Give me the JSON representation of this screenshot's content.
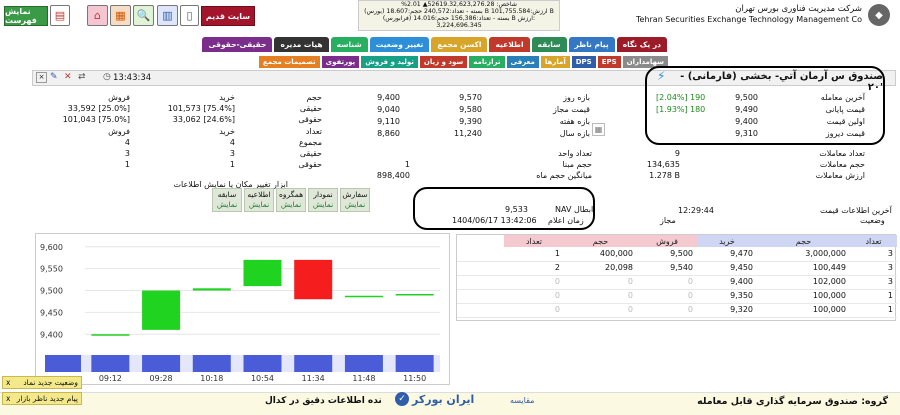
{
  "top_left": {
    "show_list": "نمایش فهرست",
    "old_site": "سایت قدیم"
  },
  "company": {
    "fa": "شرکت مدیریت فناوری بورس تهران",
    "en": "Tehran Securities Exchange Technology Management Co"
  },
  "ticker": {
    "line1": "%2.01 ▲52619.32,623,276.28 :شاخص",
    "line2": "(بورس) بسته - تعداد:240,572 حجم:18.607 B ارزش:101,755.584 B",
    "line3": "(فرابورس) بسته - تعداد:156,386 حجم:14.016 B ارزش:",
    "line4": "3,224,696.345"
  },
  "tabs_row1": [
    {
      "label": "در یک نگاه",
      "color": "#9b1b28"
    },
    {
      "label": "پیام ناظر",
      "color": "#3478c3"
    },
    {
      "label": "سابقه",
      "color": "#2e8b57"
    },
    {
      "label": "اطلاعیه",
      "color": "#c0392b"
    },
    {
      "label": "اکسن مجمع",
      "color": "#d8a42a"
    },
    {
      "label": "تغییر وضعیت",
      "color": "#2d8fd8"
    },
    {
      "label": "شناسه",
      "color": "#27ae60"
    },
    {
      "label": "هیات مدیره",
      "color": "#333"
    },
    {
      "label": "حقیقی-حقوقی",
      "color": "#7b2d8b"
    }
  ],
  "tabs_row2": [
    {
      "label": "سهامداران",
      "color": "#8a8a8a"
    },
    {
      "label": "EPS",
      "color": "#c0392b"
    },
    {
      "label": "DPS",
      "color": "#2f5da8"
    },
    {
      "label": "آمارها",
      "color": "#d8a42a"
    },
    {
      "label": "معرفی",
      "color": "#2980b9"
    },
    {
      "label": "ترازنامه",
      "color": "#27ae60"
    },
    {
      "label": "سود و زیان",
      "color": "#c0392b"
    },
    {
      "label": "تولید و فروش",
      "color": "#16a085"
    },
    {
      "label": "پورتفوی",
      "color": "#7b2d8b"
    },
    {
      "label": "تصمیمات مجمع",
      "color": "#e67e22"
    }
  ],
  "header": {
    "time": "13:43:34",
    "symbol_title": "صندوق س آرمان آتي- بخشی (فارمانی) - ۲۰'"
  },
  "right_info": [
    {
      "label": "آخرین معامله",
      "value": "9,500",
      "chg": "190",
      "pct": "[2.04%]"
    },
    {
      "label": "قیمت پایانی",
      "value": "9,490",
      "chg": "180",
      "pct": "[1.93%]"
    },
    {
      "label": "اولین قیمت",
      "value": "9,400",
      "chg": "",
      "pct": ""
    },
    {
      "label": "قیمت دیروز",
      "value": "9,310",
      "chg": "",
      "pct": ""
    }
  ],
  "right_stats": [
    {
      "label": "تعداد معاملات",
      "value": "9"
    },
    {
      "label": "حجم معاملات",
      "value": "134,635"
    },
    {
      "label": "ارزش معاملات",
      "value": "1.278 B"
    }
  ],
  "mid_ranges": [
    {
      "label": "بازه روز",
      "a": "9,570",
      "b": "9,400"
    },
    {
      "label": "قیمت مجاز",
      "a": "9,580",
      "b": "9,040"
    },
    {
      "label": "بازه هفته",
      "a": "9,390",
      "b": "9,110"
    },
    {
      "label": "بازه سال",
      "a": "11,240",
      "b": "8,860"
    }
  ],
  "mid_stats": [
    {
      "label": "تعداد واحد",
      "value": ""
    },
    {
      "label": "حجم مبنا",
      "value": "1"
    },
    {
      "label": "میانگین حجم ماه",
      "value": "898,400"
    }
  ],
  "left_table": {
    "headers": [
      "حجم",
      "خرید",
      "فروش"
    ],
    "rows": [
      {
        "label": "حقیقی",
        "buy": "101,573 [75.4%]",
        "sell": "33,592 [25.0%]"
      },
      {
        "label": "حقوقی",
        "buy": "33,062 [24.6%]",
        "sell": "101,043 [75.0%]"
      }
    ],
    "count_headers": [
      "تعداد",
      "خرید",
      "فروش"
    ],
    "count_rows": [
      {
        "label": "مجموع",
        "buy": "4",
        "sell": "4"
      },
      {
        "label": "حقیقی",
        "buy": "3",
        "sell": "3"
      },
      {
        "label": "حقوقی",
        "buy": "1",
        "sell": "1"
      }
    ]
  },
  "tools": {
    "title": "ابزار تغییر مکان یا نمایش اطلاعات",
    "items": [
      {
        "top": "سفارش",
        "bot": "نمایش"
      },
      {
        "top": "نمودار",
        "bot": "نمایش"
      },
      {
        "top": "همگروه",
        "bot": "نمایش"
      },
      {
        "top": "اطلاعیه",
        "bot": "نمایش"
      },
      {
        "top": "سابقه",
        "bot": "نمایش"
      }
    ]
  },
  "nav": {
    "nav_label": "NAV ابطال",
    "nav_value": "9,533",
    "date_label": "زمان اعلام",
    "date_value": "1404/06/17 13:42:06"
  },
  "status": {
    "last_info_label": "آخرین اطلاعات قیمت",
    "last_info_value": "12:29:44",
    "state_label": "وضعیت",
    "state_value": "مجاز"
  },
  "orderbook": {
    "headers": [
      "تعداد",
      "حجم",
      "خرید",
      "فروش",
      "حجم",
      "تعداد"
    ],
    "rows": [
      [
        "3",
        "3,000,000",
        "9,470",
        "9,500",
        "400,000",
        "1"
      ],
      [
        "3",
        "100,449",
        "9,450",
        "9,540",
        "20,098",
        "2"
      ],
      [
        "3",
        "102,000",
        "9,400",
        "0",
        "0",
        "0"
      ],
      [
        "1",
        "100,000",
        "9,350",
        "0",
        "0",
        "0"
      ],
      [
        "1",
        "100,000",
        "9,320",
        "0",
        "0",
        "0"
      ]
    ]
  },
  "chart_data": {
    "type": "candlestick",
    "x": [
      "09:12",
      "09:28",
      "10:18",
      "10:54",
      "11:34",
      "11:48",
      "11:50"
    ],
    "ylim": [
      9380,
      9620
    ],
    "yticks": [
      "9,600",
      "9,550",
      "9,500",
      "9,450",
      "9,400"
    ],
    "candles": [
      {
        "t": "09:12",
        "open": 9400,
        "close": 9400,
        "color": "#21d321"
      },
      {
        "t": "09:28",
        "open": 9410,
        "close": 9500,
        "color": "#21d321"
      },
      {
        "t": "10:18",
        "open": 9500,
        "close": 9505,
        "color": "#21d321"
      },
      {
        "t": "10:54",
        "open": 9510,
        "close": 9570,
        "color": "#21d321"
      },
      {
        "t": "11:34",
        "open": 9570,
        "close": 9480,
        "color": "#f51d1d"
      },
      {
        "t": "11:48",
        "open": 9485,
        "close": 9488,
        "color": "#21d321"
      },
      {
        "t": "11:50",
        "open": 9490,
        "close": 9492,
        "color": "#21d321"
      }
    ],
    "volume_color": "#4b5cd8"
  },
  "footer": {
    "group": "گروه: صندوق سرمایه گذاری قابل معامله",
    "compare": "مقایسه",
    "notice": "نده اطلاعات دقیق در کدال",
    "brand": "ایران بورکر"
  },
  "popups": [
    {
      "text": "وضعیت جدید نماد",
      "close": "x"
    },
    {
      "text": "پیام جدید ناظر بازار",
      "close": "x"
    }
  ]
}
